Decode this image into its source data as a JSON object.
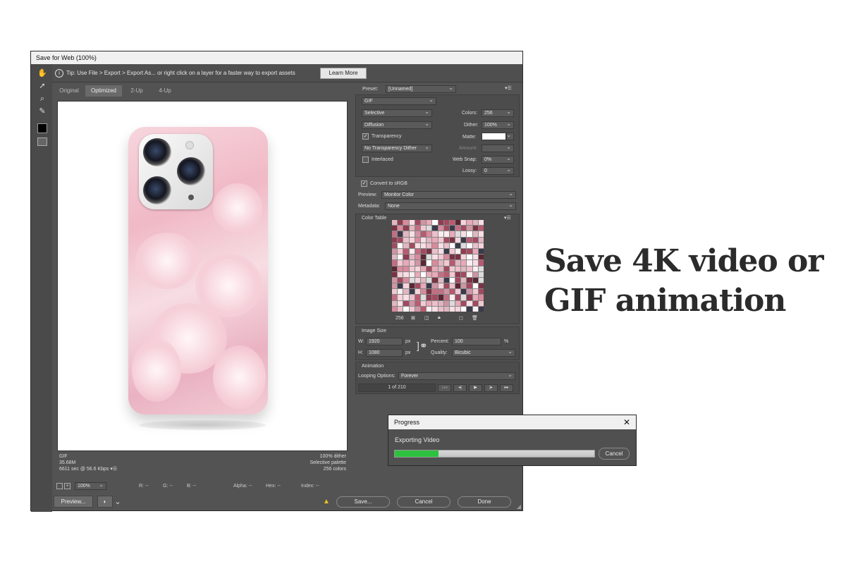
{
  "dialog": {
    "title": "Save for Web (100%)",
    "tip_text": "Tip: Use File > Export > Export As...   or right click on a layer for a faster way to export assets",
    "learn_more": "Learn More",
    "tabs": [
      "Original",
      "Optimized",
      "2-Up",
      "4-Up"
    ],
    "active_tab": "Optimized"
  },
  "info_left": {
    "format": "GIF",
    "size": "35.68M",
    "time": "6611 sec @ 56.6 Kbps"
  },
  "info_right": {
    "dither": "100% dither",
    "palette": "Selective palette",
    "colors": "256 colors"
  },
  "statusbar": {
    "zoom": "100%",
    "r": "R: --",
    "g": "G: --",
    "b": "B: --",
    "alpha": "Alpha: --",
    "hex": "Hex: --",
    "index": "Index: --"
  },
  "bottom": {
    "preview": "Preview...",
    "save": "Save...",
    "cancel": "Cancel",
    "done": "Done"
  },
  "settings": {
    "preset_label": "Preset:",
    "preset_value": "[Unnamed]",
    "format": "GIF",
    "reduction": "Selective",
    "dither_algo": "Diffusion",
    "transparency_label": "Transparency",
    "transparency_dither": "No Transparency Dither",
    "interlaced_label": "Interlaced",
    "colors_label": "Colors:",
    "colors_value": "256",
    "dither_label": "Dither:",
    "dither_value": "100%",
    "matte_label": "Matte:",
    "amount_label": "Amount:",
    "websnap_label": "Web Snap:",
    "websnap_value": "0%",
    "lossy_label": "Lossy:",
    "lossy_value": "0",
    "convert_label": "Convert to sRGB",
    "preview_label": "Preview:",
    "preview_value": "Monitor Color",
    "metadata_label": "Metadata:",
    "metadata_value": "None"
  },
  "color_table": {
    "title": "Color Table",
    "count": "256"
  },
  "image_size": {
    "title": "Image Size",
    "w_label": "W:",
    "w_value": "1920",
    "h_label": "H:",
    "h_value": "1080",
    "unit": "px",
    "percent_label": "Percent:",
    "percent_value": "100",
    "percent_unit": "%",
    "quality_label": "Quality:",
    "quality_value": "Bicubic"
  },
  "animation": {
    "title": "Animation",
    "looping_label": "Looping Options:",
    "looping_value": "Forever",
    "frame": "1 of 210"
  },
  "progress": {
    "title": "Progress",
    "message": "Exporting Video",
    "cancel": "Cancel",
    "fraction": 0.22
  },
  "headline": {
    "line1": "Save 4K video or",
    "line2": "GIF animation"
  },
  "colors": {
    "progress_fill": "#2ec13f",
    "phone_pink": "#f0b9c6"
  }
}
